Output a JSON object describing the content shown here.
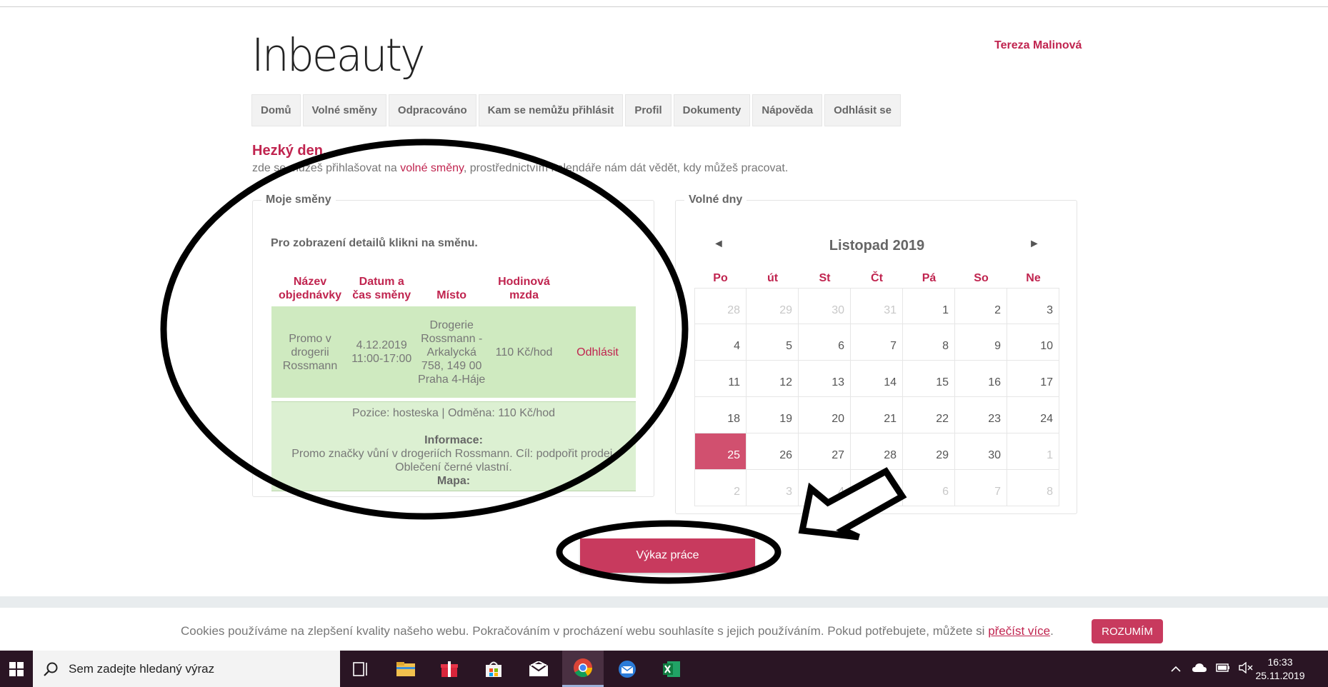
{
  "app": {
    "logo": "Inbeauty",
    "user_name": "Tereza Malinová"
  },
  "nav": [
    "Domů",
    "Volné směny",
    "Odpracováno",
    "Kam se nemůžu přihlásit",
    "Profil",
    "Dokumenty",
    "Nápověda",
    "Odhlásit se"
  ],
  "intro": {
    "greeting": "Hezký den,",
    "text_before": "zde se můžeš přihlašovat na ",
    "link": "volné směny",
    "text_after": ", prostřednictvím kalendáře nám dát vědět, kdy můžeš pracovat."
  },
  "shifts": {
    "legend": "Moje směny",
    "hint": "Pro zobrazení detailů klikni na směnu.",
    "headers": [
      "Název objednávky",
      "Datum a čas směny",
      "Místo",
      "Hodinová mzda"
    ],
    "row": {
      "name": "Promo v drogerii Rossmann",
      "datetime": "4.12.2019 11:00-17:00",
      "place": "Drogerie Rossmann - Arkalycká 758, 149 00 Praha 4-Háje",
      "wage": "110 Kč/hod",
      "action": "Odhlásit"
    },
    "details": {
      "position_line": "Pozice: hosteska | Odměna: 110 Kč/hod",
      "info_label": "Informace:",
      "info_text": "Promo značky vůní v drogeriích Rossmann. Cíl: podpořit prodej.",
      "info_text2": "Oblečení černé vlastní.",
      "map_label": "Mapa:"
    }
  },
  "calendar": {
    "legend": "Volné dny",
    "month": "Listopad 2019",
    "prev": "◄",
    "next": "►",
    "weekdays": [
      "Po",
      "út",
      "St",
      "Čt",
      "Pá",
      "So",
      "Ne"
    ],
    "weeks": [
      [
        {
          "d": "28",
          "m": true
        },
        {
          "d": "29",
          "m": true
        },
        {
          "d": "30",
          "m": true
        },
        {
          "d": "31",
          "m": true
        },
        {
          "d": "1"
        },
        {
          "d": "2"
        },
        {
          "d": "3"
        }
      ],
      [
        {
          "d": "4"
        },
        {
          "d": "5"
        },
        {
          "d": "6"
        },
        {
          "d": "7"
        },
        {
          "d": "8"
        },
        {
          "d": "9"
        },
        {
          "d": "10"
        }
      ],
      [
        {
          "d": "11"
        },
        {
          "d": "12"
        },
        {
          "d": "13"
        },
        {
          "d": "14"
        },
        {
          "d": "15"
        },
        {
          "d": "16"
        },
        {
          "d": "17"
        }
      ],
      [
        {
          "d": "18"
        },
        {
          "d": "19"
        },
        {
          "d": "20"
        },
        {
          "d": "21"
        },
        {
          "d": "22"
        },
        {
          "d": "23"
        },
        {
          "d": "24"
        }
      ],
      [
        {
          "d": "25",
          "today": true
        },
        {
          "d": "26"
        },
        {
          "d": "27"
        },
        {
          "d": "28"
        },
        {
          "d": "29"
        },
        {
          "d": "30"
        },
        {
          "d": "1",
          "m": true
        }
      ],
      [
        {
          "d": "2",
          "m": true
        },
        {
          "d": "3",
          "m": true
        },
        {
          "d": "4",
          "m": true
        },
        {
          "d": "5",
          "m": true
        },
        {
          "d": "6",
          "m": true
        },
        {
          "d": "7",
          "m": true
        },
        {
          "d": "8",
          "m": true
        }
      ]
    ]
  },
  "report_button": "Výkaz práce",
  "cookie": {
    "text": "Cookies používáme na zlepšení kvality našeho webu. Pokračováním v procházení webu souhlasíte s jejich používáním. Pokud potřebujete, můžete si ",
    "link": "přečíst více",
    "end": ".",
    "button": "ROZUMÍM"
  },
  "taskbar": {
    "search_placeholder": "Sem zadejte hledaný výraz",
    "time": "16:33",
    "date": "25.11.2019"
  },
  "colors": {
    "brand": "#c0244f",
    "button": "#c83a5e",
    "shift_row": "#cfeac0",
    "today": "#d1506f"
  }
}
